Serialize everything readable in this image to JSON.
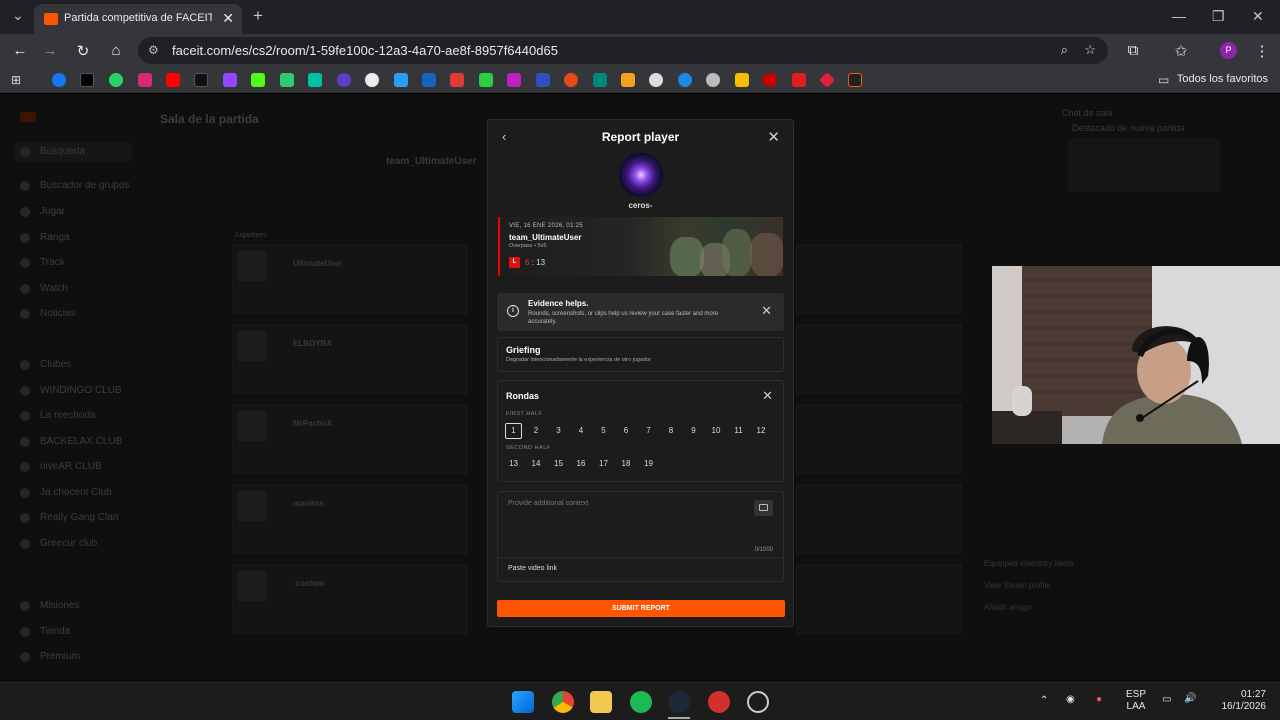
{
  "browser": {
    "tab_title": "Partida competitiva de FACEIT -",
    "url": "faceit.com/es/cs2/room/1-59fe100c-12a3-4a70-ae8f-8957f6440d65",
    "bookmarks_all_label": "Todos los favoritos"
  },
  "background": {
    "room_title": "Sala de la partida",
    "team_left": "team_UltimateUser",
    "chat_title": "Chat de sala",
    "featured": "Destacado de nueva partida",
    "players_label": "Jugadores",
    "sidebar_items": [
      "Búsqueda",
      "Buscador de grupos",
      "Jugar",
      "Ranga",
      "Track",
      "Watch",
      "Noticias",
      "Clubes",
      "WINDINGO CLUB",
      "La reechoda",
      "BACKELAX CLUB",
      "niveAR CLUB",
      "Ja chocent Club",
      "Really Gang Clan",
      "Greecur club",
      "Misiones",
      "Tienda",
      "Premium"
    ],
    "players_left": [
      "UltimateUser",
      "ELBOYBA",
      "MrPachoX",
      "manitos",
      "-custom"
    ],
    "right_menu": [
      "Equipped inventory items",
      "View Steam profile",
      "Añadir amigo"
    ]
  },
  "modal": {
    "title": "Report player",
    "player_name": "ceros-",
    "match": {
      "date": "VIE, 16 ENE 2026, 01:25",
      "team": "team_UltimateUser",
      "map": "Overpass • 5v5",
      "result": "L",
      "score_left": "6",
      "score_sep": ":",
      "score_right": "13"
    },
    "evidence": {
      "title": "Evidence helps.",
      "desc": "Rounds, screenshots, or clips help us review your case faster and more accurately."
    },
    "reason": {
      "title": "Griefing",
      "desc": "Degradar intencionadamente la experiencia de otro jugador"
    },
    "rounds": {
      "title": "Rondas",
      "first_half_label": "FIRST HALF",
      "second_half_label": "SECOND HALF",
      "first_half": [
        "1",
        "2",
        "3",
        "4",
        "5",
        "6",
        "7",
        "8",
        "9",
        "10",
        "11",
        "12"
      ],
      "second_half": [
        "13",
        "14",
        "15",
        "16",
        "17",
        "18",
        "19"
      ],
      "selected": "1"
    },
    "context": {
      "placeholder": "Provide additional context",
      "counter": "0/1000",
      "video_link": "Paste video link"
    },
    "submit_label": "SUBMIT REPORT"
  },
  "taskbar": {
    "lang1": "ESP",
    "lang2": "LAA",
    "time": "01:27",
    "date": "16/1/2026"
  },
  "colors": {
    "accent": "#ff5500",
    "loss": "#dd1111"
  }
}
